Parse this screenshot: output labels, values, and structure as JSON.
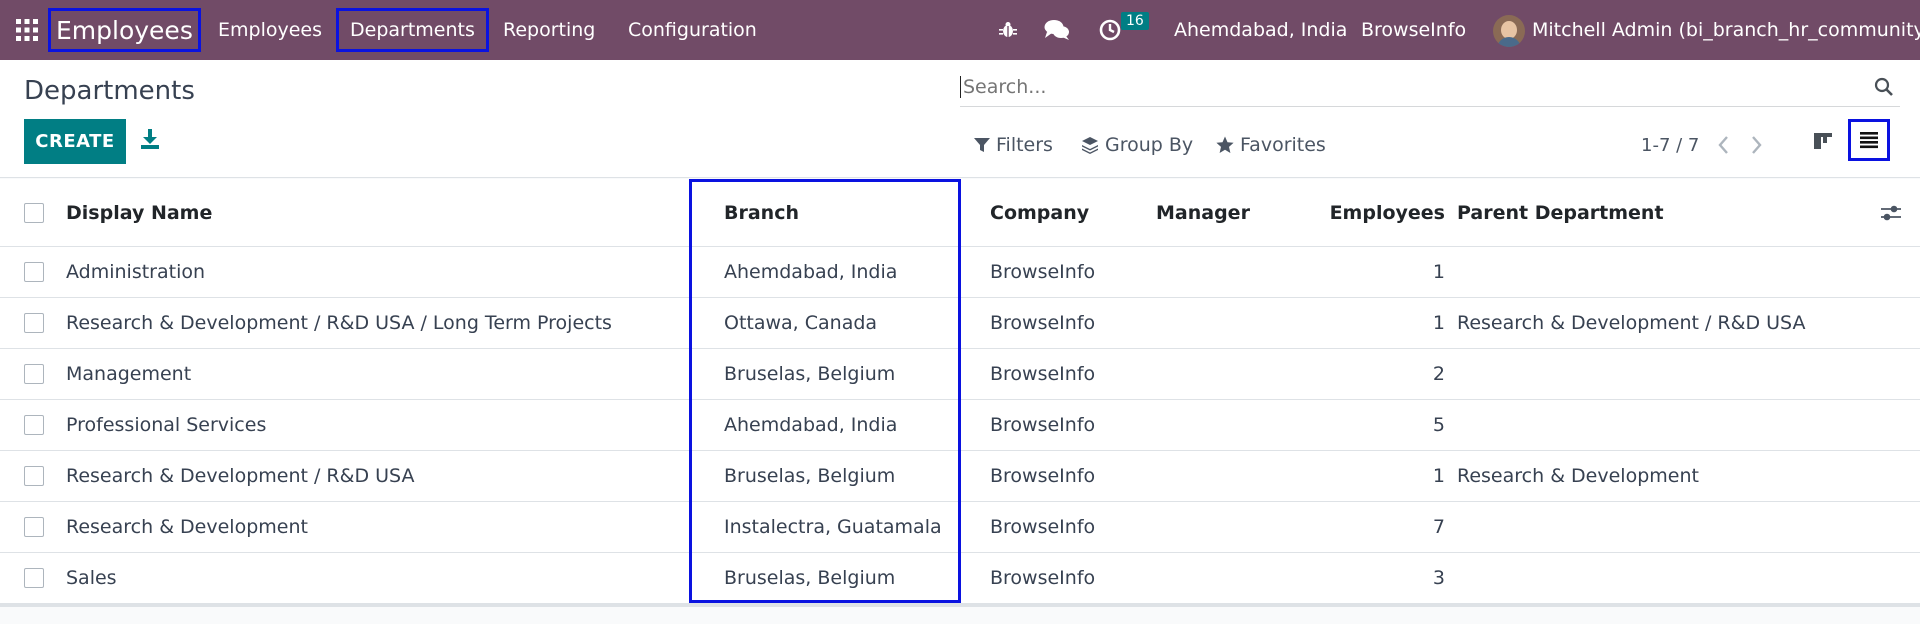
{
  "app": {
    "name": "Employees"
  },
  "nav": {
    "items": [
      {
        "label": "Employees"
      },
      {
        "label": "Departments"
      },
      {
        "label": "Reporting"
      },
      {
        "label": "Configuration"
      }
    ]
  },
  "systray": {
    "activity_count": "16",
    "branch": "Ahemdabad, India",
    "company": "BrowseInfo",
    "user": "Mitchell Admin (bi_branch_hr_community)"
  },
  "control": {
    "title": "Departments",
    "create_label": "CREATE",
    "search_placeholder": "Search...",
    "filters_label": "Filters",
    "groupby_label": "Group By",
    "favorites_label": "Favorites",
    "pager": "1-7 / 7"
  },
  "colors": {
    "topbar": "#714b67",
    "primary": "#017e84",
    "highlight": "#0a12e0"
  },
  "table": {
    "columns": [
      "Display Name",
      "Branch",
      "Company",
      "Manager",
      "Employees",
      "Parent Department"
    ],
    "rows": [
      {
        "name": "Administration",
        "branch": "Ahemdabad, India",
        "company": "BrowseInfo",
        "manager": "",
        "employees": "1",
        "parent": ""
      },
      {
        "name": "Research & Development / R&D USA / Long Term Projects",
        "branch": "Ottawa, Canada",
        "company": "BrowseInfo",
        "manager": "",
        "employees": "1",
        "parent": "Research & Development / R&D USA"
      },
      {
        "name": "Management",
        "branch": "Bruselas, Belgium",
        "company": "BrowseInfo",
        "manager": "",
        "employees": "2",
        "parent": ""
      },
      {
        "name": "Professional Services",
        "branch": "Ahemdabad, India",
        "company": "BrowseInfo",
        "manager": "",
        "employees": "5",
        "parent": ""
      },
      {
        "name": "Research & Development / R&D USA",
        "branch": "Bruselas, Belgium",
        "company": "BrowseInfo",
        "manager": "",
        "employees": "1",
        "parent": "Research & Development"
      },
      {
        "name": "Research & Development",
        "branch": "Instalectra, Guatamala",
        "company": "BrowseInfo",
        "manager": "",
        "employees": "7",
        "parent": ""
      },
      {
        "name": "Sales",
        "branch": "Bruselas, Belgium",
        "company": "BrowseInfo",
        "manager": "",
        "employees": "3",
        "parent": ""
      }
    ]
  }
}
